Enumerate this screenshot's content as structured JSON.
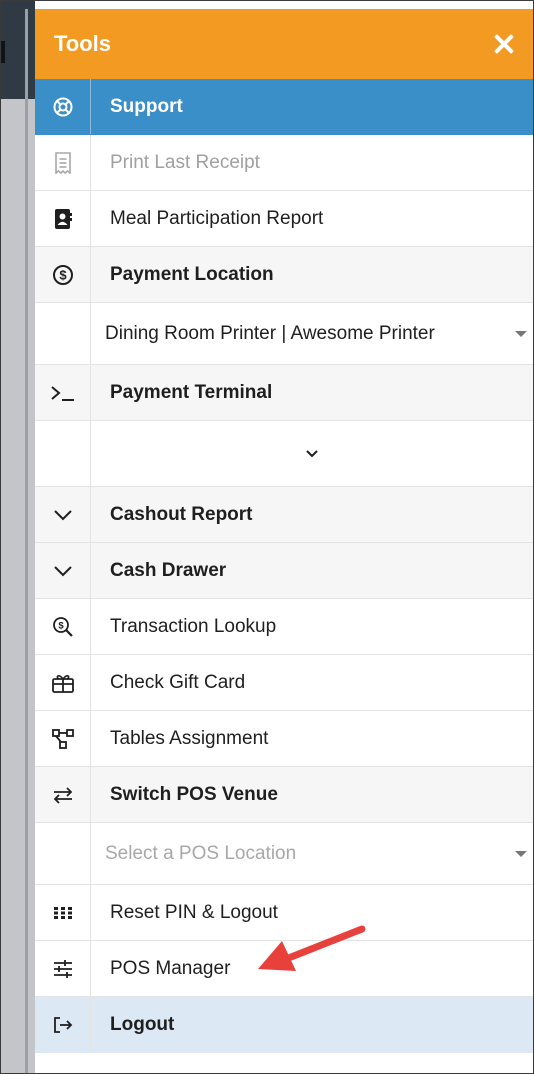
{
  "header": {
    "title": "Tools"
  },
  "menu": {
    "support": "Support",
    "print_last_receipt": "Print Last Receipt",
    "meal_participation_report": "Meal Participation Report",
    "payment_location": "Payment Location",
    "payment_location_select": "Dining Room Printer | Awesome Printer",
    "payment_terminal": "Payment Terminal",
    "cashout_report": "Cashout Report",
    "cash_drawer": "Cash Drawer",
    "transaction_lookup": "Transaction Lookup",
    "check_gift_card": "Check Gift Card",
    "tables_assignment": "Tables Assignment",
    "switch_pos_venue": "Switch POS Venue",
    "pos_location_placeholder": "Select a POS Location",
    "reset_pin_logout": "Reset PIN & Logout",
    "pos_manager": "POS Manager",
    "logout": "Logout"
  },
  "colors": {
    "header": "#f29a22",
    "active": "#3a8fc8",
    "logout_bg": "#dce9f5",
    "annotation_arrow": "#e8413c"
  },
  "icons": {
    "support": "lifebuoy-icon",
    "print_last_receipt": "receipt-icon",
    "meal_participation_report": "contact-card-icon",
    "payment_location": "dollar-circle-icon",
    "payment_terminal": "terminal-prompt-icon",
    "cashout_report": "chevron-down-icon",
    "cash_drawer": "chevron-down-icon",
    "transaction_lookup": "search-dollar-icon",
    "check_gift_card": "gift-card-icon",
    "tables_assignment": "hierarchy-icon",
    "switch_pos_venue": "swap-arrows-icon",
    "reset_pin_logout": "keypad-grid-icon",
    "pos_manager": "sliders-icon",
    "logout": "logout-icon"
  }
}
